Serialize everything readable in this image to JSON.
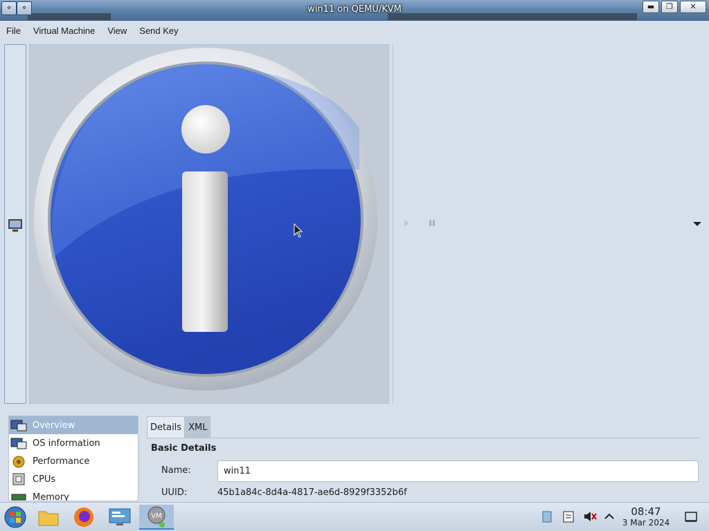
{
  "window": {
    "title": "win11 on QEMU/KVM",
    "sys_menu_glyph": "⋄",
    "minimize_glyph": "▬",
    "restore_glyph": "❐",
    "close_glyph": "✕"
  },
  "menubar": {
    "items": [
      "File",
      "Virtual Machine",
      "View",
      "Send Key"
    ]
  },
  "viewer": {
    "screen_icon": "info-icon",
    "colors": {
      "circle_blue": "#2f4fc0",
      "ring": "#e6e9ee",
      "screen_bg": "#c3ccd6"
    }
  },
  "details": {
    "nav": [
      {
        "label": "Overview",
        "icon": "overview-icon",
        "selected": true
      },
      {
        "label": "OS information",
        "icon": "os-info-icon",
        "selected": false
      },
      {
        "label": "Performance",
        "icon": "performance-icon",
        "selected": false
      },
      {
        "label": "CPUs",
        "icon": "cpu-icon",
        "selected": false
      },
      {
        "label": "Memory",
        "icon": "memory-icon",
        "selected": false
      }
    ],
    "tabs": [
      "Details",
      "XML"
    ],
    "section_title": "Basic Details",
    "name_label": "Name:",
    "name_value": "win11",
    "uuid_label": "UUID:",
    "uuid_value": "45b1a84c-8d4a-4817-ae6d-8929f3352b6f"
  },
  "taskbar": {
    "time": "08:47",
    "date": "3 Mar 2024"
  }
}
